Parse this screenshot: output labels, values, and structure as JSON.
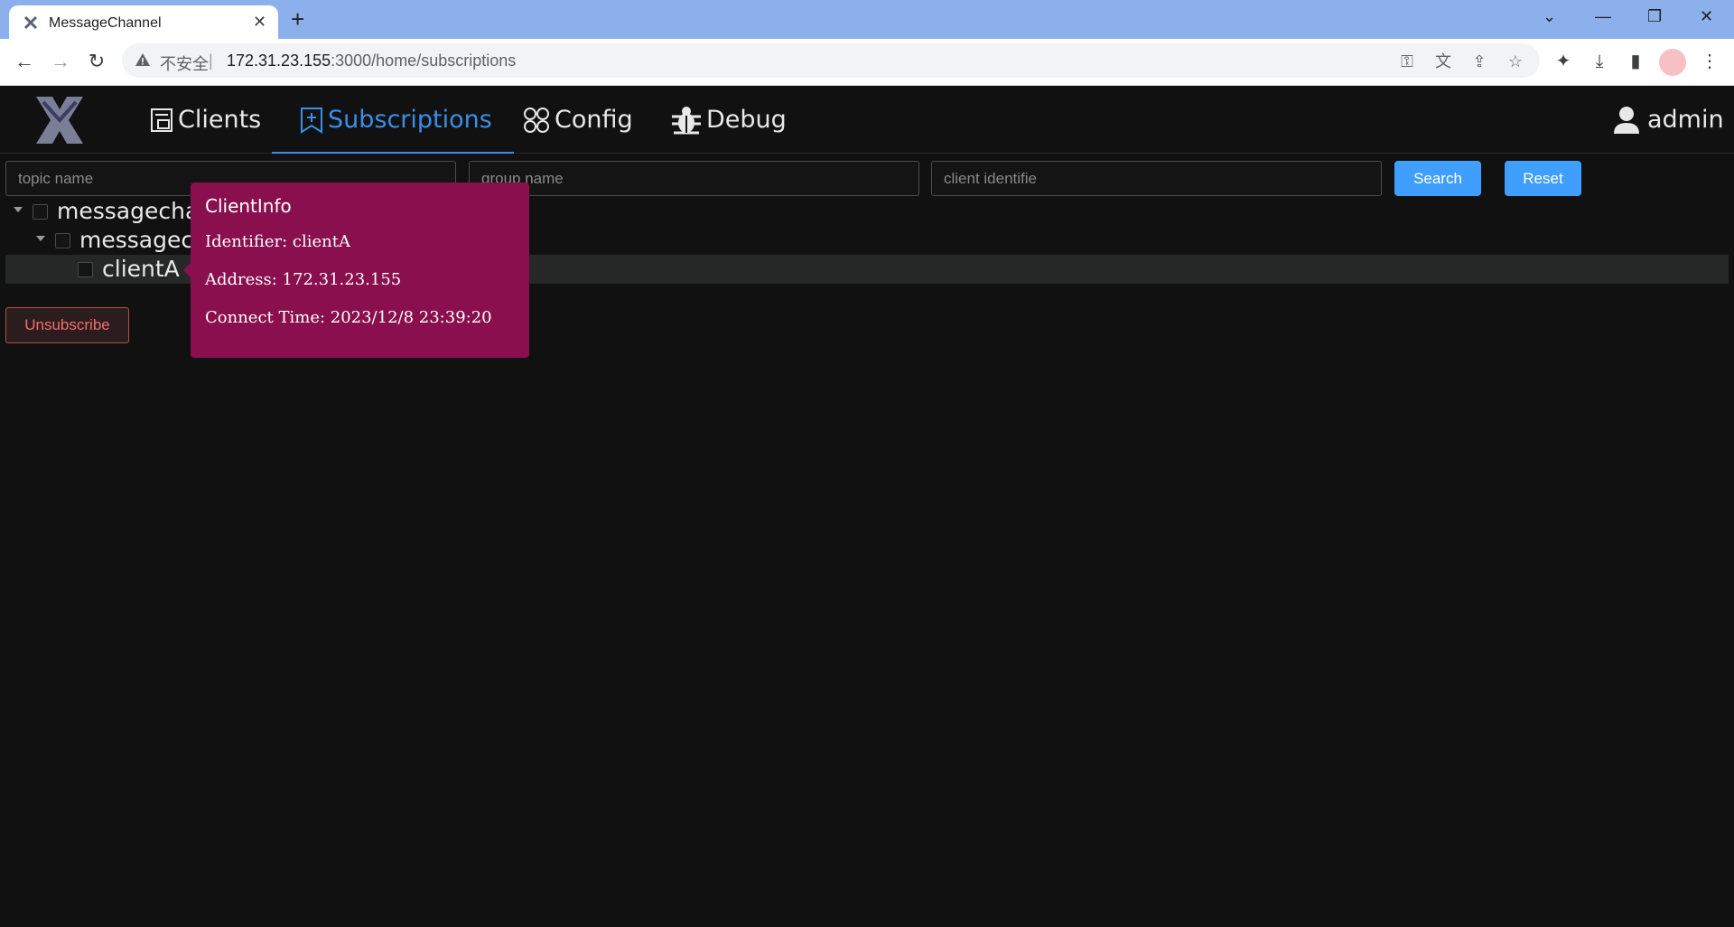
{
  "browser": {
    "tab_title": "MessageChannel",
    "insecure_label": "不安全",
    "separator": "|",
    "url_host": "172.31.23.155",
    "url_path": ":3000/home/subscriptions"
  },
  "nav": {
    "items": [
      {
        "label": "Clients",
        "icon": "monitor-icon",
        "active": false
      },
      {
        "label": "Subscriptions",
        "icon": "bookmark-plus-icon",
        "active": true
      },
      {
        "label": "Config",
        "icon": "apps-icon",
        "active": false
      },
      {
        "label": "Debug",
        "icon": "bug-icon",
        "active": false
      }
    ],
    "user": "admin"
  },
  "search": {
    "topic_placeholder": "topic name",
    "group_placeholder": "group name",
    "client_placeholder": "client identifie",
    "search_label": "Search",
    "reset_label": "Reset"
  },
  "tree": {
    "level0": "messagecha",
    "level1": "messagecl",
    "level2": "clientA"
  },
  "actions": {
    "unsubscribe_label": "Unsubscribe"
  },
  "popover": {
    "title": "ClientInfo",
    "identifier": "Identifier: clientA",
    "address": "Address: 172.31.23.155",
    "connect_time": "Connect Time: 2023/12/8 23:39:20"
  },
  "colors": {
    "accent": "#409eff",
    "active_nav": "#3a8ee6",
    "popover_bg": "#8a0f4e",
    "danger": "#f56c6c"
  }
}
